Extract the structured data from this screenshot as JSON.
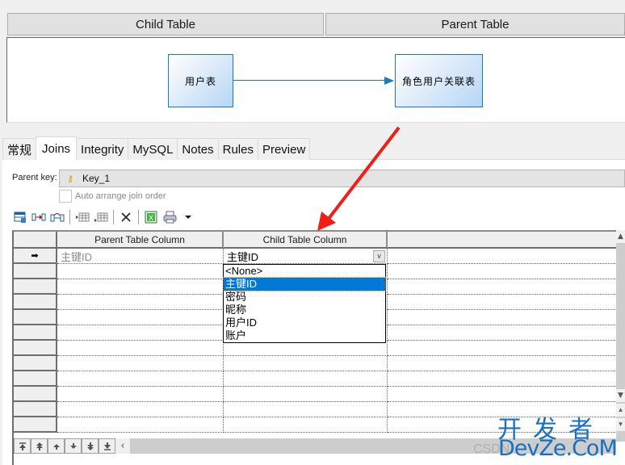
{
  "header": {
    "child_table_label": "Child Table",
    "parent_table_label": "Parent Table"
  },
  "diagram": {
    "child_table_name": "用户表",
    "parent_table_name": "角色用户关联表",
    "accent_color": "#1a7dbb"
  },
  "tabs": [
    {
      "label": "常规",
      "active": false
    },
    {
      "label": "Joins",
      "active": true
    },
    {
      "label": "Integrity",
      "active": false
    },
    {
      "label": "MySQL",
      "active": false
    },
    {
      "label": "Notes",
      "active": false
    },
    {
      "label": "Rules",
      "active": false
    },
    {
      "label": "Preview",
      "active": false
    }
  ],
  "joins": {
    "parent_key_label": "Parent key:",
    "parent_key_value": "Key_1",
    "auto_arrange_label": "Auto arrange join order",
    "auto_arrange_checked": false
  },
  "toolbar": {
    "icons": [
      "properties-icon",
      "add-join-icon",
      "reuse-columns-icon",
      "insert-row-icon",
      "add-row-icon",
      "delete-icon",
      "excel-export-icon",
      "print-icon",
      "dropdown-arrow-icon"
    ]
  },
  "grid": {
    "columns": [
      "Parent Table Column",
      "Child Table Column"
    ],
    "rows": [
      {
        "parent_column": "主键ID",
        "child_column": "主键ID",
        "current": true
      }
    ],
    "current_row_marker": "➡"
  },
  "dropdown": {
    "options": [
      "<None>",
      "主键ID",
      "密码",
      "昵称",
      "用户ID",
      "账户"
    ],
    "selected": "主键ID"
  },
  "nav_buttons": [
    "move-top-icon",
    "move-page-up-icon",
    "move-up-icon",
    "move-down-icon",
    "move-page-down-icon",
    "move-bottom-icon"
  ],
  "watermark": {
    "line1": "开发者",
    "line2": "DevZe.CoM",
    "csdn": "CSDN"
  }
}
